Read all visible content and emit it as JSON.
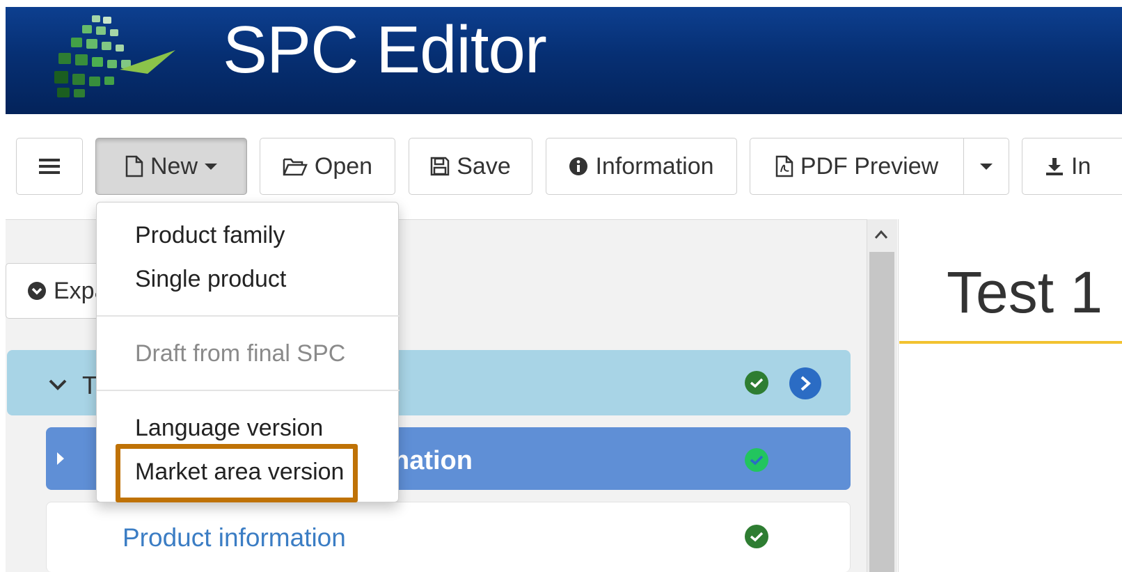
{
  "app": {
    "title": "SPC Editor"
  },
  "toolbar": {
    "new_label": "New",
    "open_label": "Open",
    "save_label": "Save",
    "information_label": "Information",
    "pdf_preview_label": "PDF Preview",
    "import_label": "In"
  },
  "new_menu": {
    "items": [
      {
        "label": "Product family",
        "enabled": true
      },
      {
        "label": "Single product",
        "enabled": true
      },
      {
        "label": "Draft from final SPC",
        "enabled": false
      },
      {
        "label": "Language version",
        "enabled": true
      },
      {
        "label": "Market area version",
        "enabled": true,
        "highlighted": true
      }
    ]
  },
  "left_panel": {
    "expand_label": "Expa",
    "tree": [
      {
        "label_fragment": "T",
        "status": "ok"
      },
      {
        "label_fragment": "nation",
        "status": "ok",
        "selected": true
      },
      {
        "label": "Product information",
        "status": "ok"
      }
    ]
  },
  "document": {
    "title_fragment": "Test 1"
  },
  "colors": {
    "header_blue": "#062f73",
    "tree_header_bg": "#a8d4e6",
    "selected_row_bg": "#5f8fd6",
    "ok_green": "#2e7d32",
    "link_blue": "#3b7dc4",
    "highlight_orange": "#bf7206",
    "title_underline": "#f2c230"
  }
}
